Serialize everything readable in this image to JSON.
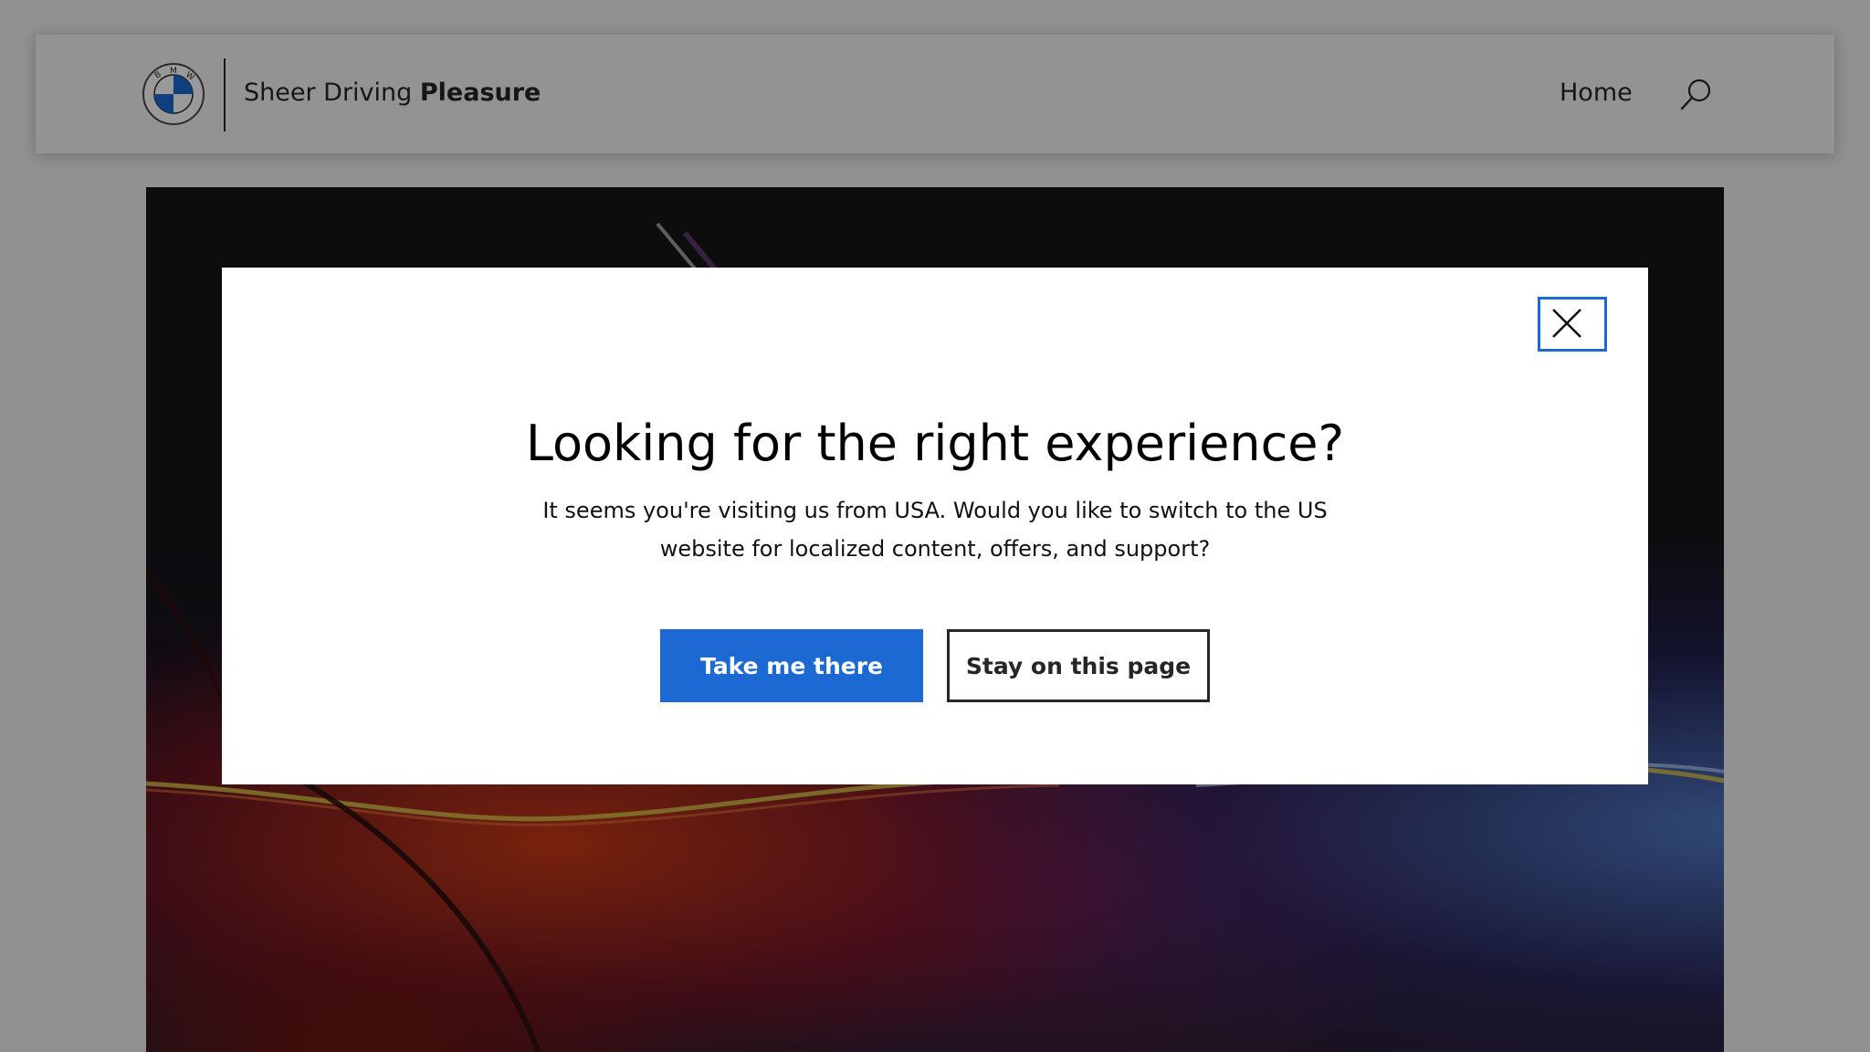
{
  "header": {
    "logo_icon": "bmw-roundel-icon",
    "logo_letters": "BMW",
    "tagline_regular": "Sheer Driving ",
    "tagline_bold": "Pleasure",
    "nav": [
      {
        "label": "Home"
      }
    ],
    "search_icon": "search-icon"
  },
  "hero": {
    "image": "car-detail-red-blue-light"
  },
  "modal": {
    "close_icon": "close-icon",
    "title": "Looking for the right experience?",
    "message": "It seems you're visiting us from USA. Would you like to switch to the US website for localized content, offers, and support?",
    "primary_button": "Take me there",
    "secondary_button": "Stay on this page"
  },
  "colors": {
    "accent": "#1c69d4",
    "text": "#262626",
    "modal_background": "#ffffff"
  }
}
